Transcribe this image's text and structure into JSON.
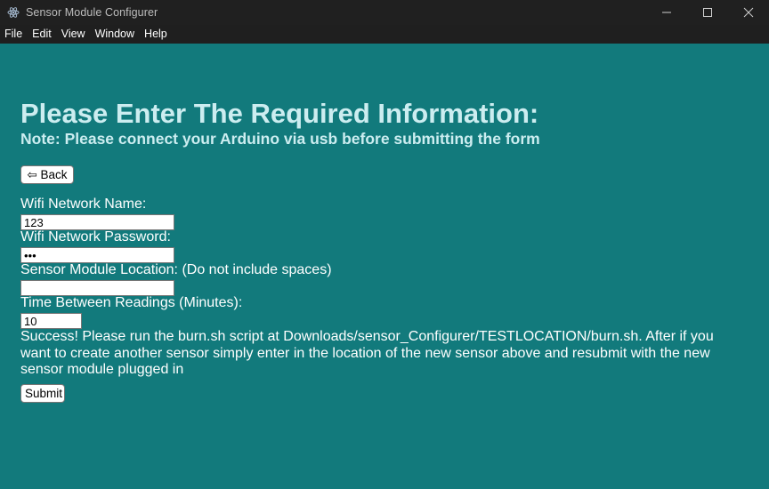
{
  "window": {
    "title": "Sensor Module Configurer",
    "icon": "electron-atom-icon"
  },
  "menu": [
    "File",
    "Edit",
    "View",
    "Window",
    "Help"
  ],
  "form": {
    "heading": "Please Enter The Required Information:",
    "note": "Note: Please connect your Arduino via usb before submitting the form",
    "back_label": "⇦ Back",
    "fields": {
      "wifi_name": {
        "label": "Wifi Network Name:",
        "value": "123"
      },
      "wifi_password": {
        "label": "Wifi Network Password:",
        "value": "•••"
      },
      "location": {
        "label": "Sensor Module Location: (Do not include spaces)",
        "value": ""
      },
      "interval": {
        "label": "Time Between Readings (Minutes):",
        "value": "10"
      }
    },
    "success_message": "Success! Please run the burn.sh script at Downloads/sensor_Configurer/TESTLOCATION/burn.sh. After if you want to create another sensor simply enter in the location of the new sensor above and resubmit with the new sensor module plugged in",
    "submit_label": "Submit"
  },
  "colors": {
    "background": "#127a7c",
    "heading": "#ccedf0",
    "titlebar": "#202020"
  }
}
